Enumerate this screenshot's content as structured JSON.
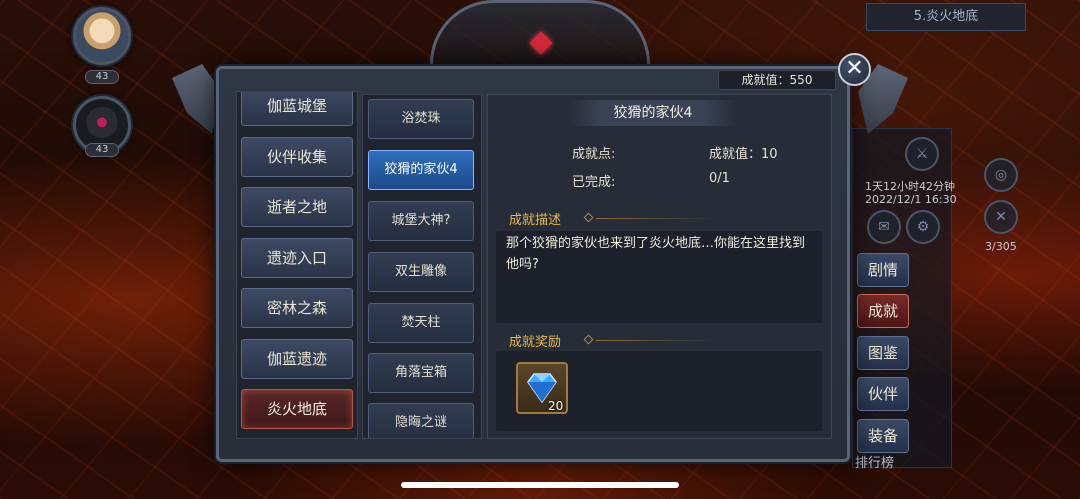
{
  "party": {
    "members": [
      {
        "level": "43"
      },
      {
        "level": "43"
      }
    ]
  },
  "hud": {
    "stage_title": "5.炎火地底",
    "timer": "1天12小时42分钟",
    "date": "2022/12/1 16:30",
    "counter": "3/305",
    "side_buttons": [
      {
        "label": "剧情"
      },
      {
        "label": "成就"
      },
      {
        "label": "图鉴"
      },
      {
        "label": "伙伴"
      },
      {
        "label": "装备"
      }
    ],
    "rank_label": "排行榜"
  },
  "modal": {
    "score_label": "成就值：550",
    "close_glyph": "✕",
    "regions": [
      {
        "label": "伽蓝城堡"
      },
      {
        "label": "伙伴收集"
      },
      {
        "label": "逝者之地"
      },
      {
        "label": "遗迹入口"
      },
      {
        "label": "密林之森"
      },
      {
        "label": "伽蓝遗迹"
      },
      {
        "label": "炎火地底"
      }
    ],
    "achievements": [
      {
        "label": "浴焚珠"
      },
      {
        "label": "狡猾的家伙4"
      },
      {
        "label": "城堡大神?"
      },
      {
        "label": "双生雕像"
      },
      {
        "label": "焚天柱"
      },
      {
        "label": "角落宝箱"
      },
      {
        "label": "隐晦之谜"
      }
    ],
    "detail": {
      "title": "狡猾的家伙4",
      "points_label": "成就点:",
      "value_label": "成就值：10",
      "completed_label": "已完成:",
      "completed_value": "0/1",
      "desc_heading": "成就描述",
      "desc_text": "那个狡猾的家伙也来到了炎火地底…你能在这里找到他吗?",
      "reward_heading": "成就奖励",
      "reward_icon": "diamond-icon",
      "reward_count": "20"
    }
  },
  "colors": {
    "accent_gold": "#e6b94a",
    "active_blue": "#2e6fbf",
    "active_red": "#5a2a2a"
  }
}
